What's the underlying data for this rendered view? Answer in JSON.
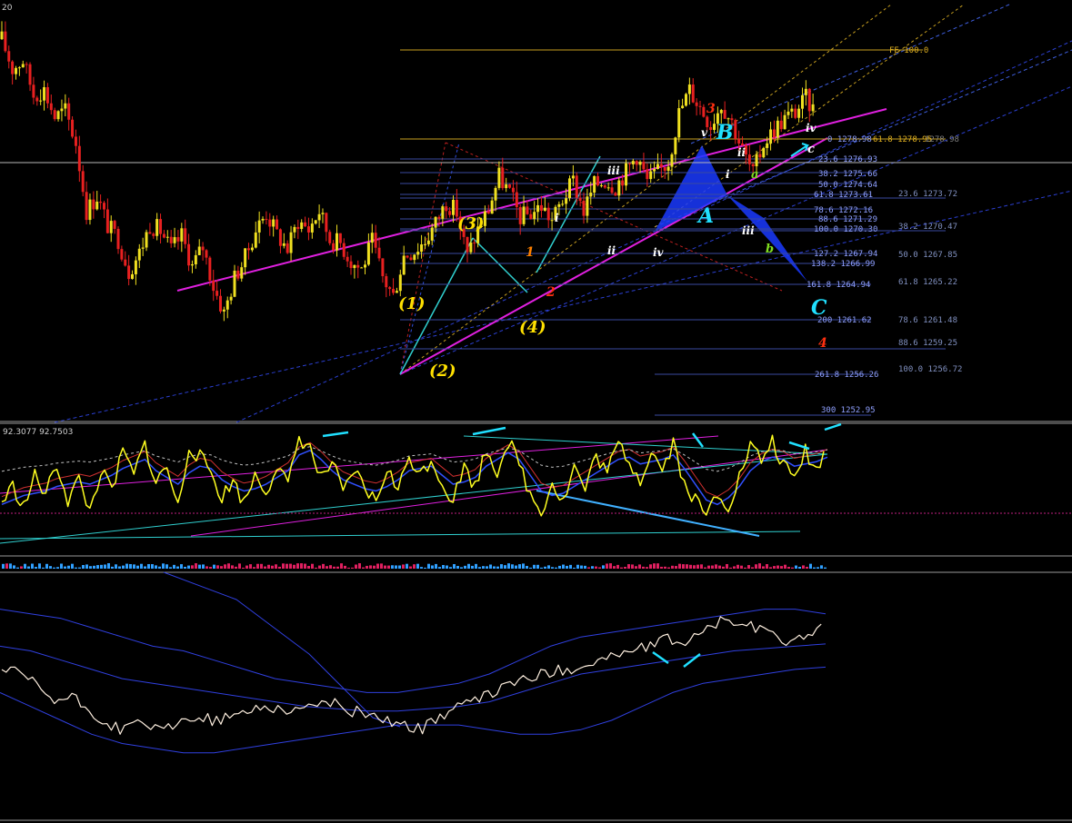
{
  "chart_data": [
    {
      "type": "line",
      "panel": "price",
      "corner_label": "20",
      "fib_right": {
        "labels": [
          "FE 100.0",
          "0 1278.98",
          "61.8 1278.95",
          "1278.98",
          "23.6 1276.93",
          "38.2 1275.66",
          "50.0 1274.64",
          "61.8 1273.61",
          "78.6 1272.16",
          "88.6 1271.29",
          "100.0 1270.30",
          "127.2 1267.94",
          "138.2 1266.99",
          "161.8 1264.94",
          "200 1261.62",
          "261.8 1256.26",
          "300 1252.95"
        ],
        "outer": [
          "23.6 1273.72",
          "38.2 1270.47",
          "50.0 1267.85",
          "61.8 1265.22",
          "78.6 1261.48",
          "88.6 1259.25",
          "100.0 1256.72"
        ]
      },
      "wave_labels": {
        "yellow": [
          "(1)",
          "(2)",
          "(3)",
          "(4)"
        ],
        "orange": [
          "1",
          "2",
          "3",
          "4"
        ],
        "white": [
          "i",
          "ii",
          "iii",
          "iv",
          "v",
          "i",
          "ii",
          "iii",
          "iv"
        ],
        "cyan": [
          "A",
          "B",
          "C"
        ],
        "green": [
          "a",
          "b",
          "c"
        ]
      },
      "series": [
        {
          "values": [
            1282.3,
            1279.9,
            1280.6,
            1277.8,
            1278.2,
            1276.0,
            1276.5,
            1273.9,
            1268.4,
            1269.6,
            1267.2,
            1266.1,
            1263.5,
            1265.0,
            1267.3,
            1266.8,
            1265.2,
            1266.4,
            1263.9,
            1265.5,
            1262.3,
            1260.1,
            1263.0,
            1264.6,
            1266.9,
            1268.2,
            1266.5,
            1265.3,
            1267.6,
            1266.9,
            1268.4,
            1266.1,
            1265.8,
            1264.3,
            1263.7,
            1265.9,
            1263.0,
            1261.5,
            1264.8,
            1265.2,
            1266.0,
            1267.4,
            1269.1,
            1268.3,
            1264.7,
            1266.9,
            1268.5,
            1271.2,
            1269.8,
            1267.9,
            1268.2,
            1268.8,
            1267.6,
            1269.3,
            1270.8,
            1268.4,
            1270.5,
            1270.9,
            1270.4,
            1271.6,
            1272.9,
            1270.8,
            1271.5,
            1272.4,
            1276.3,
            1278.2,
            1276.8,
            1275.4,
            1277.1,
            1275.6,
            1273.3,
            1271.4,
            1273.9,
            1275.0,
            1275.9,
            1276.4,
            1277.5,
            1276.2
          ]
        }
      ]
    },
    {
      "type": "line",
      "panel": "oscillator",
      "header": "92.3077 92.7503",
      "series": [
        {
          "values": [
            38,
            52,
            34,
            61,
            45,
            72,
            40,
            58,
            30,
            66,
            48,
            83,
            62,
            90,
            55,
            70,
            33,
            88,
            78,
            65,
            42,
            58,
            37,
            63,
            48,
            71,
            52,
            96,
            86,
            58,
            74,
            44,
            66,
            50,
            38,
            69,
            47,
            80,
            62,
            77,
            55,
            40,
            70,
            52,
            85,
            66,
            93,
            72,
            45,
            30,
            56,
            38,
            70,
            49,
            80,
            64,
            90,
            75,
            58,
            84,
            67,
            92,
            54,
            40,
            26,
            47,
            35,
            60,
            88,
            75,
            92,
            70,
            58,
            84,
            66,
            90
          ]
        },
        {
          "values": [
            40,
            44,
            48,
            50,
            52,
            56,
            58,
            60,
            58,
            62,
            66,
            72,
            76,
            80,
            70,
            64,
            58,
            68,
            74,
            72,
            62,
            56,
            52,
            54,
            58,
            64,
            70,
            84,
            88,
            80,
            70,
            62,
            58,
            54,
            52,
            56,
            62,
            70,
            72,
            74,
            66,
            58,
            60,
            64,
            74,
            80,
            86,
            80,
            66,
            52,
            48,
            50,
            56,
            62,
            68,
            74,
            80,
            82,
            76,
            78,
            80,
            84,
            72,
            58,
            44,
            40,
            46,
            56,
            70,
            78,
            82,
            80,
            74,
            76,
            78,
            82
          ]
        }
      ]
    },
    {
      "type": "line",
      "panel": "bands",
      "series": [
        {
          "values": [
            62,
            60,
            55,
            48,
            50,
            44,
            38,
            36,
            40,
            35,
            38,
            42,
            40,
            41,
            44,
            46,
            45,
            44,
            48,
            47,
            44,
            43,
            40,
            38,
            36,
            42,
            46,
            48,
            52,
            56,
            58,
            60,
            62,
            63,
            66,
            68,
            70,
            72,
            75,
            74,
            78,
            83,
            82,
            80,
            76,
            74,
            78,
            80
          ]
        },
        {
          "values": [
            88,
            86,
            84,
            80,
            76,
            72,
            70,
            66,
            62,
            58,
            56,
            54,
            52,
            52,
            54,
            56,
            60,
            66,
            72,
            76,
            78,
            80,
            82,
            84,
            86,
            88,
            88,
            86
          ]
        },
        {
          "values": [
            72,
            70,
            66,
            62,
            58,
            56,
            54,
            52,
            50,
            48,
            46,
            45,
            44,
            44,
            45,
            46,
            48,
            52,
            56,
            60,
            62,
            64,
            66,
            68,
            70,
            71,
            72,
            73
          ]
        },
        {
          "values": [
            52,
            46,
            40,
            34,
            30,
            28,
            26,
            26,
            28,
            30,
            32,
            34,
            36,
            38,
            38,
            38,
            36,
            34,
            34,
            36,
            40,
            46,
            52,
            56,
            58,
            60,
            62,
            63
          ]
        }
      ]
    }
  ]
}
